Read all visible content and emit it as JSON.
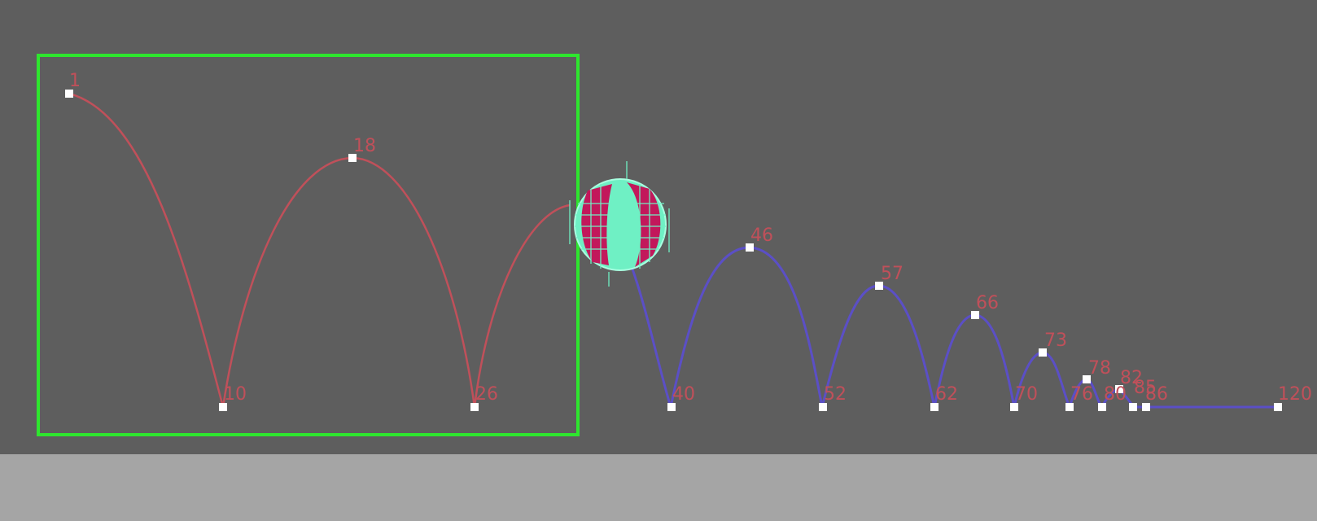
{
  "viewport": {
    "background": "#5e5e5e",
    "floor_color": "#a5a5a5"
  },
  "motion_path": {
    "frame_labels": [
      "1",
      "18",
      "10",
      "26",
      "40",
      "46",
      "52",
      "57",
      "62",
      "66",
      "70",
      "73",
      "76",
      "78",
      "80",
      "82",
      "85",
      "86",
      "120"
    ],
    "label_color": "#c0505a",
    "past_segment_color": "#c0505a",
    "future_segment_color": "#5b4fc6",
    "key_color": "#ffffff"
  },
  "selection": {
    "color": "#2ee62e"
  },
  "ball": {
    "icon": "wireframe-ball-icon",
    "wire_color": "#6ff0c4",
    "panel_color": "#c2185b"
  }
}
